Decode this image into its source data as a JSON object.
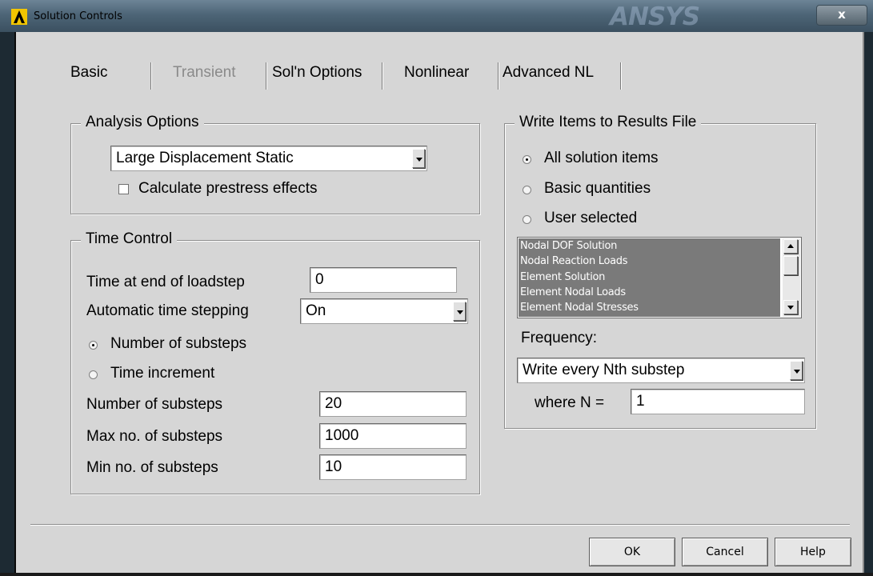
{
  "window": {
    "title": "Solution Controls",
    "brand": "ANSYS",
    "close_label": "x"
  },
  "tabs": [
    {
      "label": "Basic",
      "enabled": true,
      "selected": true
    },
    {
      "label": "Transient",
      "enabled": false
    },
    {
      "label": "Sol'n Options",
      "enabled": true
    },
    {
      "label": "Nonlinear",
      "enabled": true
    },
    {
      "label": "Advanced NL",
      "enabled": true
    }
  ],
  "analysis_options": {
    "legend": "Analysis Options",
    "analysis_type": "Large Displacement Static",
    "prestress_label": "Calculate prestress effects",
    "prestress_checked": false
  },
  "time_control": {
    "legend": "Time Control",
    "end_time_label": "Time at end of loadstep",
    "end_time_value": "0",
    "auto_step_label": "Automatic time stepping",
    "auto_step_value": "On",
    "radio_substeps_label": "Number of substeps",
    "radio_increment_label": "Time increment",
    "selected_mode": "Number of substeps",
    "num_substeps_label": "Number of substeps",
    "num_substeps_value": "20",
    "max_substeps_label": "Max no. of substeps",
    "max_substeps_value": "1000",
    "min_substeps_label": "Min no. of substeps",
    "min_substeps_value": "10"
  },
  "results_file": {
    "legend": "Write Items to Results File",
    "radio_all_label": "All solution items",
    "radio_basic_label": "Basic quantities",
    "radio_user_label": "User selected",
    "selected_option": "All solution items",
    "items": [
      "Nodal DOF Solution",
      "Nodal Reaction Loads",
      "Element Solution",
      "Element Nodal Loads",
      "Element Nodal Stresses"
    ],
    "frequency_label": "Frequency:",
    "frequency_value": "Write every Nth substep",
    "n_label": "where N =",
    "n_value": "1"
  },
  "buttons": {
    "ok": "OK",
    "cancel": "Cancel",
    "help": "Help"
  },
  "colors": {
    "dialog_bg": "#d6d6d6",
    "list_disabled_bg": "#7a7a7a",
    "titlebar": "#4d6577"
  }
}
